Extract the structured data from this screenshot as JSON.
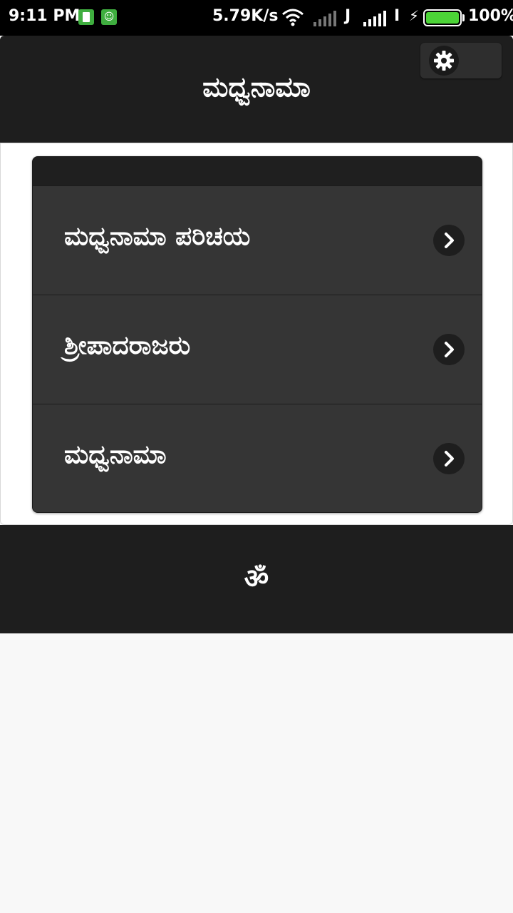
{
  "status_bar": {
    "time": "9:11 PM",
    "speed": "5.79K/s",
    "carrier_j": "J",
    "carrier_i": "I",
    "battery_pct": "100%",
    "battery_level": 1.0
  },
  "header": {
    "title": "ಮಧ್ವನಾಮಾ",
    "settings_icon": "gear-icon"
  },
  "list": {
    "items": [
      {
        "label": "ಮಧ್ವನಾಮಾ ಪರಿಚಯ",
        "icon": "chevron-right-icon"
      },
      {
        "label": "ಶ್ರೀಪಾದರಾಜರು",
        "icon": "chevron-right-icon"
      },
      {
        "label": "ಮಧ್ವನಾಮಾ",
        "icon": "chevron-right-icon"
      }
    ]
  },
  "footer": {
    "symbol": "ॐ"
  },
  "colors": {
    "header_bg": "#1e1e1e",
    "list_bg": "#353535",
    "battery": "#4cd437",
    "page_bg": "#f8f8f8"
  }
}
